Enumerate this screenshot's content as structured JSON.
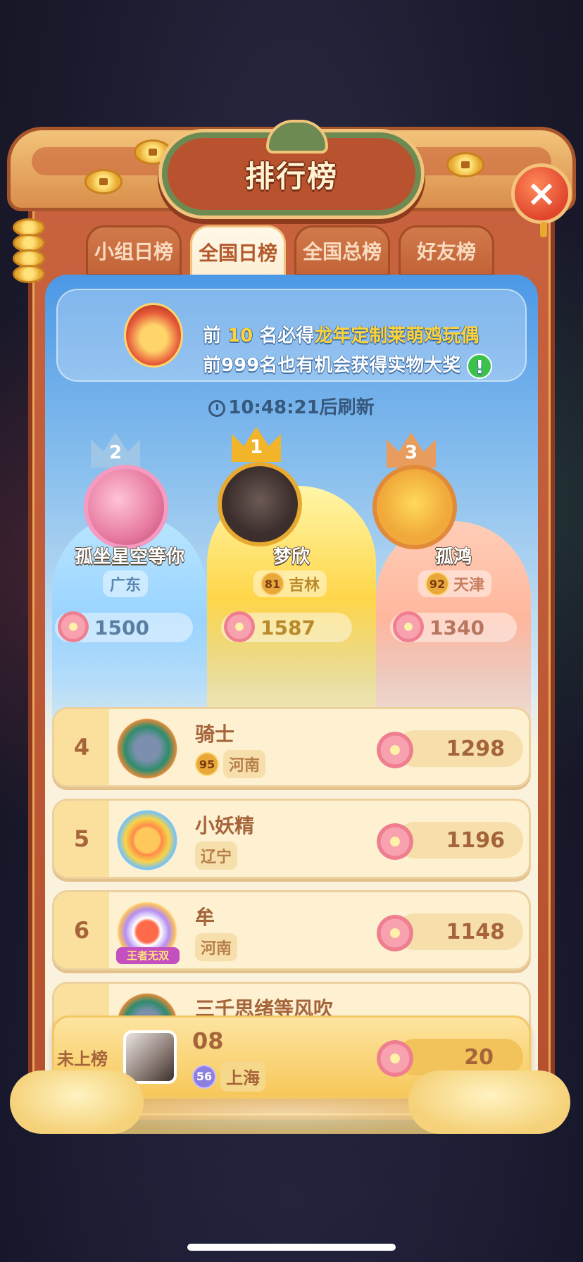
{
  "title": "排行榜",
  "tabs": [
    {
      "label": "小组日榜",
      "active": false
    },
    {
      "label": "全国日榜",
      "active": true
    },
    {
      "label": "全国总榜",
      "active": false
    },
    {
      "label": "好友榜",
      "active": false
    }
  ],
  "banner": {
    "line1_prefix": "前 ",
    "line1_rank": "10",
    "line1_mid": " 名必得",
    "line1_prize": "龙年定制莱萌鸡玩偶",
    "line2": "前999名也有机会获得实物大奖",
    "info_icon": "!"
  },
  "refresh": {
    "icon": "clock-icon",
    "text": "10:48:21后刷新"
  },
  "top_three": [
    {
      "rank": "2",
      "name": "孤坐星空等你",
      "region": "广东",
      "level": "",
      "score": "1500"
    },
    {
      "rank": "1",
      "name": "梦欣",
      "region": "吉林",
      "level": "81",
      "score": "1587"
    },
    {
      "rank": "3",
      "name": "孤鸿",
      "region": "天津",
      "level": "92",
      "score": "1340"
    }
  ],
  "rows": [
    {
      "rank": "4",
      "name": "骑士",
      "level": "95",
      "region": "河南",
      "score": "1298"
    },
    {
      "rank": "5",
      "name": "小妖精",
      "level": "",
      "region": "辽宁",
      "score": "1196"
    },
    {
      "rank": "6",
      "name": "牟",
      "level": "",
      "region": "河南",
      "score": "1148",
      "tag": "王者无双"
    },
    {
      "rank": "",
      "name": "三千思绪等风吹",
      "level": "",
      "region": "",
      "score": ""
    }
  ],
  "my_rank": {
    "label": "未上榜",
    "name": "08",
    "level": "56",
    "region": "上海",
    "score": "20"
  },
  "colors": {
    "frame": "#c8633e",
    "tab_active": "#fff8ea",
    "gold": "#f2b52a",
    "accent_text": "#a5643a"
  }
}
